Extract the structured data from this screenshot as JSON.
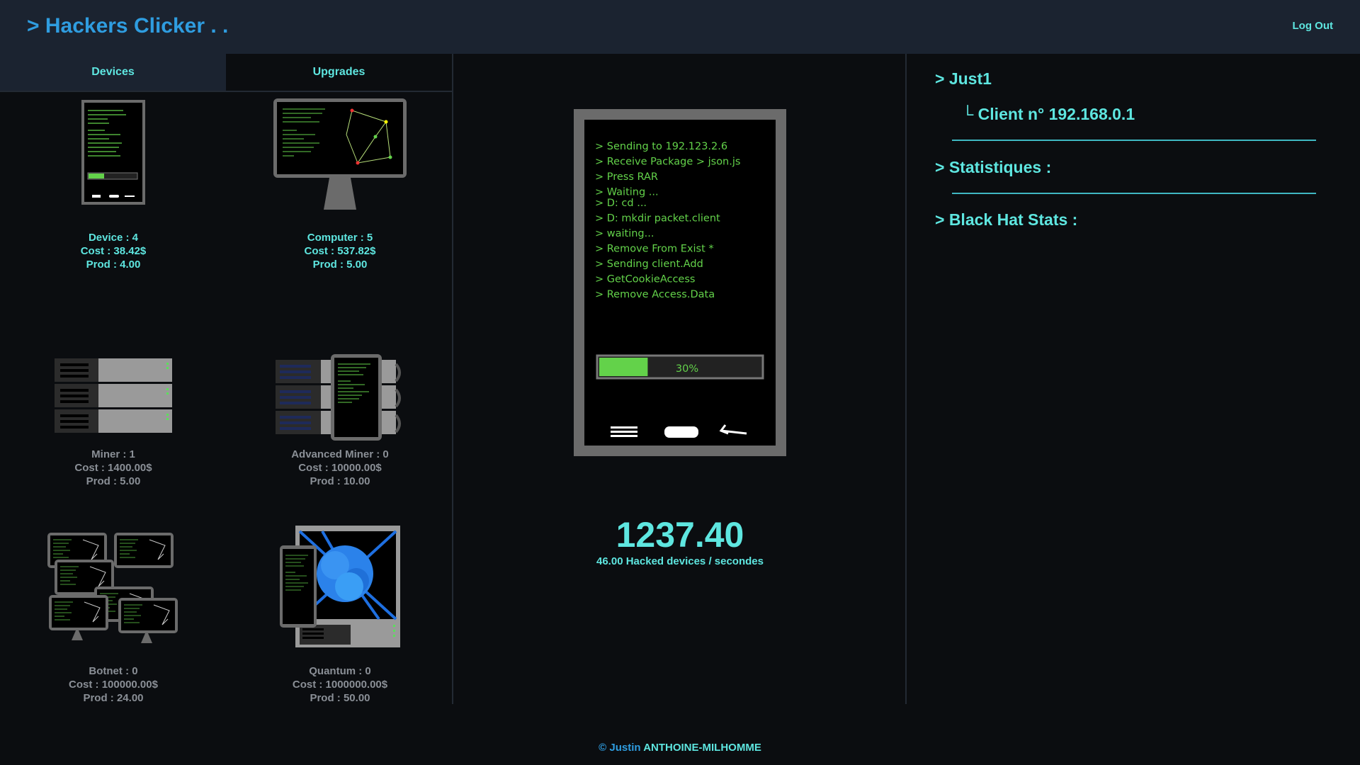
{
  "header": {
    "brand": "> Hackers Clicker . .",
    "logout": "Log Out"
  },
  "tabs": [
    {
      "label": "Devices",
      "active": true
    },
    {
      "label": "Upgrades",
      "active": false
    }
  ],
  "items": [
    {
      "name": "Device : 4",
      "cost": "Cost : 38.42$",
      "prod": "Prod : 4.00",
      "state": "affordable",
      "icon": "phone-icon"
    },
    {
      "name": "Computer : 5",
      "cost": "Cost : 537.82$",
      "prod": "Prod : 5.00",
      "state": "affordable",
      "icon": "monitor-icon"
    },
    {
      "name": "Miner : 1",
      "cost": "Cost : 1400.00$",
      "prod": "Prod : 5.00",
      "state": "locked",
      "icon": "server-rack-icon"
    },
    {
      "name": "Advanced Miner : 0",
      "cost": "Cost : 10000.00$",
      "prod": "Prod : 10.00",
      "state": "locked",
      "icon": "advanced-server-icon"
    },
    {
      "name": "Botnet : 0",
      "cost": "Cost : 100000.00$",
      "prod": "Prod : 24.00",
      "state": "locked",
      "icon": "botnet-icon"
    },
    {
      "name": "Quantum : 0",
      "cost": "Cost : 1000000.00$",
      "prod": "Prod : 50.00",
      "state": "locked",
      "icon": "quantum-icon"
    }
  ],
  "terminal": {
    "lines_top": [
      "> Sending to 192.123.2.6",
      "> Receive Package > json.js",
      "> Press RAR",
      "> Waiting ..."
    ],
    "lines_bottom": [
      "> D: cd ...",
      "> D: mkdir packet.client",
      "> waiting...",
      "> Remove From Exist *",
      "> Sending client.Add",
      "> GetCookieAccess",
      "> Remove Access.Data"
    ],
    "progress_label": "30%",
    "progress_fraction": 0.3
  },
  "stats": {
    "count": "1237.40",
    "rate": "46.00 Hacked devices / secondes"
  },
  "profile": {
    "user": "> Just1",
    "client": "└ Client n° 192.168.0.1",
    "statistics_title": "> Statistiques :",
    "blackhat_title": "> Black Hat Stats :"
  },
  "footer": {
    "prefix": "© Justin",
    "name": "ANTHOINE-MILHOMME"
  },
  "colors": {
    "background": "#0b0d10",
    "header": "#1b2330",
    "accent_cyan": "#5ee6e0",
    "accent_blue": "#2f9de0",
    "terminal_green": "#63d24a",
    "locked_text": "#8a8f96"
  }
}
